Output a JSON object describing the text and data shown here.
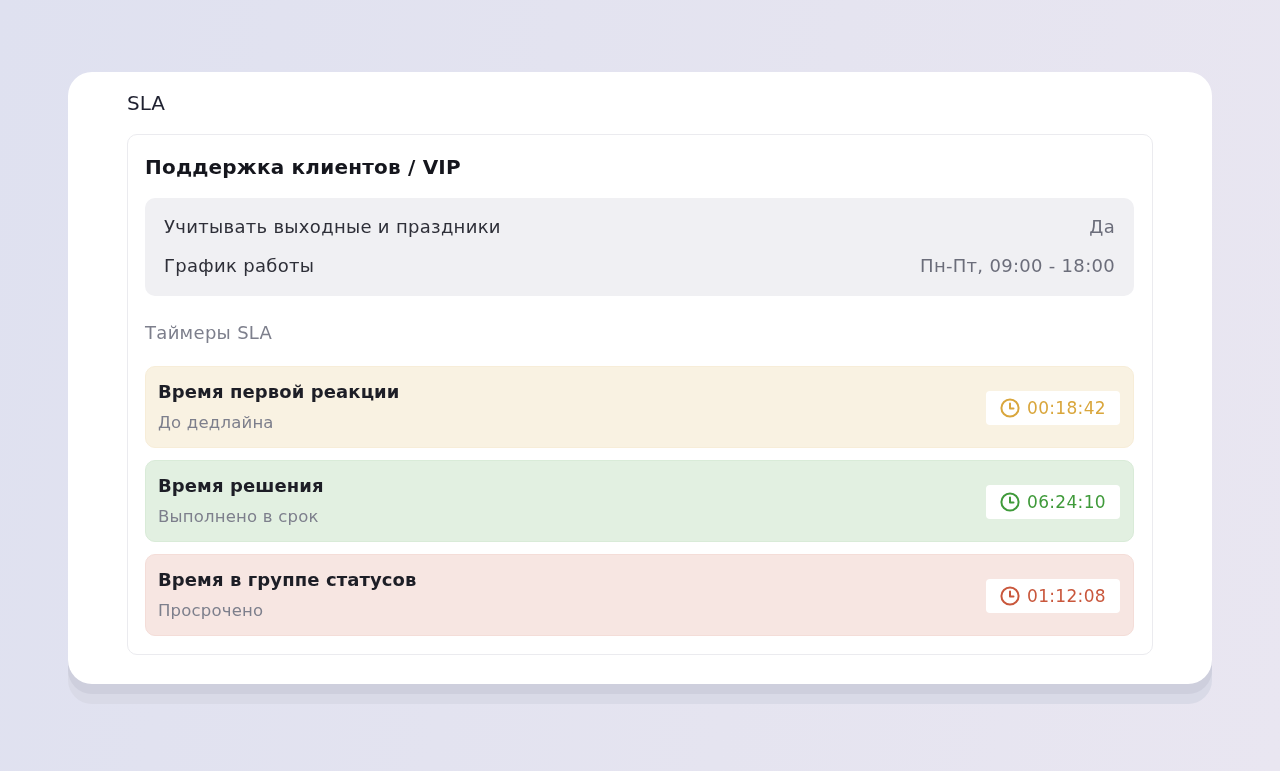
{
  "section_title": "SLA",
  "card": {
    "title": "Поддержка клиентов / VIP",
    "settings": [
      {
        "label": "Учитывать выходные и праздники",
        "value": "Да"
      },
      {
        "label": "График работы",
        "value": "Пн-Пт, 09:00 - 18:00"
      }
    ],
    "timers_heading": "Таймеры SLA",
    "timers": [
      {
        "name": "Время первой реакции",
        "status": "До дедлайна",
        "time": "00:18:42",
        "color": "#d9a63c"
      },
      {
        "name": "Время решения",
        "status": "Выполнено в срок",
        "time": "06:24:10",
        "color": "#3f9a3a"
      },
      {
        "name": "Время в группе статусов",
        "status": "Просрочено",
        "time": "01:12:08",
        "color": "#c9573c"
      }
    ]
  }
}
